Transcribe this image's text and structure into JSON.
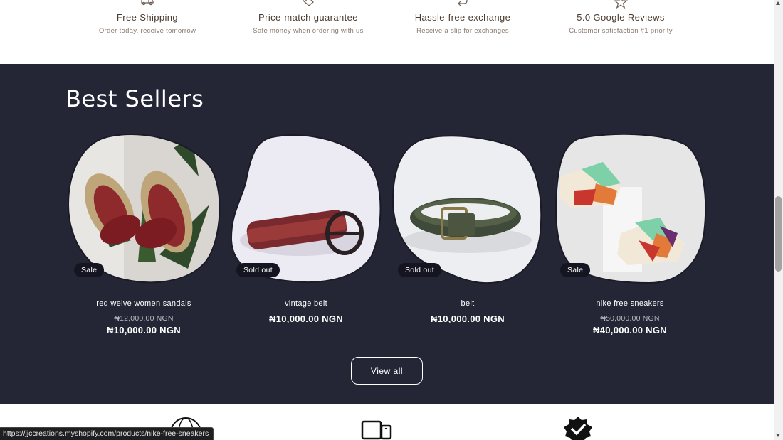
{
  "features": [
    {
      "icon": "truck-icon",
      "title": "Free Shipping",
      "subtitle": "Order today, receive tomorrow"
    },
    {
      "icon": "tag-icon",
      "title": "Price-match guarantee",
      "subtitle": "Safe money when ordering with us"
    },
    {
      "icon": "return-arrow-icon",
      "title": "Hassle-free exchange",
      "subtitle": "Receive a slip for exchanges"
    },
    {
      "icon": "star-icon",
      "title": "5.0 Google Reviews",
      "subtitle": "Customer satisfaction #1 priority"
    }
  ],
  "best_sellers": {
    "heading": "Best Sellers",
    "products": [
      {
        "name": "red weive women sandals",
        "badge": "Sale",
        "old_price": "₦12,000.00 NGN",
        "price": "₦10,000.00 NGN"
      },
      {
        "name": "vintage belt",
        "badge": "Sold out",
        "old_price": "",
        "price": "₦10,000.00 NGN"
      },
      {
        "name": "belt",
        "badge": "Sold out",
        "old_price": "",
        "price": "₦10,000.00 NGN"
      },
      {
        "name": "nike free sneakers",
        "badge": "Sale",
        "old_price": "₦50,000.00 NGN",
        "price": "₦40,000.00 NGN"
      }
    ],
    "view_all_label": "View all"
  },
  "bottom_icons": [
    "globe-icon",
    "devices-icon",
    "verified-badge-icon"
  ],
  "status_bar": {
    "url": "https://jjccreations.myshopify.com/products/nike-free-sneakers"
  },
  "colors": {
    "section_bg": "#242636",
    "feature_title": "#4a3a2e",
    "feature_subtitle": "#8a7a6e"
  }
}
